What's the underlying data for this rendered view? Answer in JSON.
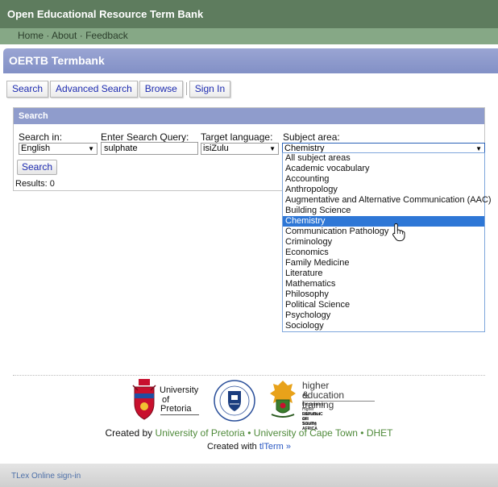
{
  "header": {
    "site_title": "Open Educational Resource Term Bank",
    "nav": [
      "Home",
      "About",
      "Feedback"
    ],
    "nav_separator": "·"
  },
  "app": {
    "title": "OERTB Termbank"
  },
  "tabs": [
    "Search",
    "Advanced Search",
    "Browse",
    "Sign In"
  ],
  "search_panel": {
    "heading": "Search",
    "search_in_label": "Search in:",
    "search_in_value": "English",
    "query_label": "Enter Search Query:",
    "query_value": "sulphate",
    "target_label": "Target language:",
    "target_value": "isiZulu",
    "subject_label": "Subject area:",
    "subject_value": "Chemistry",
    "search_button": "Search",
    "results_text": "Results: 0"
  },
  "subject_options": [
    "All subject areas",
    "Academic vocabulary",
    "Accounting",
    "Anthropology",
    "Augmentative and Alternative Communication (AAC)",
    "Building Science",
    "Chemistry",
    "Communication Pathology",
    "Criminology",
    "Economics",
    "Family Medicine",
    "Literature",
    "Mathematics",
    "Philosophy",
    "Political Science",
    "Psychology",
    "Sociology"
  ],
  "selected_subject": "Chemistry",
  "logos": {
    "up_line1": "University",
    "up_line2": "of",
    "up_line3": "Pretoria",
    "dhet_line1": "higher education",
    "dhet_line2": "& training",
    "dhet_line3": "Department:",
    "dhet_line4": "Higher Education and Training",
    "dhet_line5": "REPUBLIC OF SOUTH AFRICA"
  },
  "footer": {
    "created_by_prefix": "Created by ",
    "up_link": "University of Pretoria",
    "uct_link": "University of Cape Town",
    "dhet_link": "DHET",
    "bullet": " • ",
    "created_with_prefix": "Created with ",
    "tlterm_link": "tlTerm »",
    "tlex_signin": "TLex Online sign-in"
  },
  "colors": {
    "banner": "#5e7c5e",
    "nav_bar": "#86a886",
    "app_bar": "#8f9ccc",
    "selected_option": "#2e77d6",
    "footer_link_green": "#4f8a3a"
  }
}
